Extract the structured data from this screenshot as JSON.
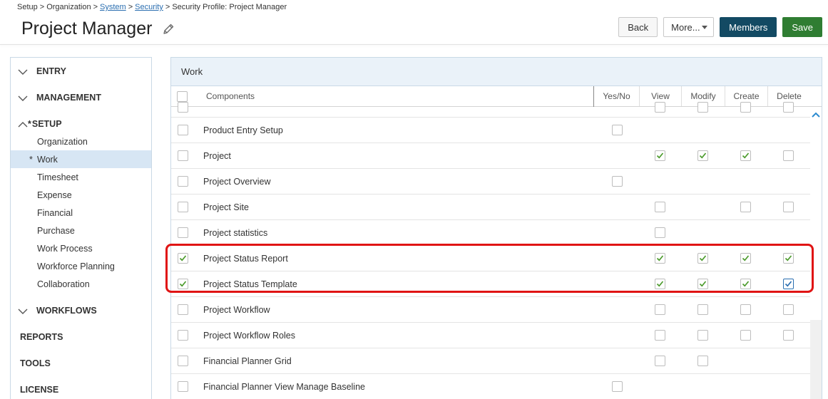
{
  "breadcrumb": {
    "items": [
      "Setup",
      "Organization",
      "System",
      "Security",
      "Security Profile: Project Manager"
    ],
    "separator": ">"
  },
  "page": {
    "title": "Project Manager"
  },
  "actions": {
    "back": "Back",
    "more": "More...",
    "members": "Members",
    "save": "Save"
  },
  "sidebar": {
    "sections": [
      {
        "label": "ENTRY",
        "state": "collapsed"
      },
      {
        "label": "MANAGEMENT",
        "state": "collapsed"
      },
      {
        "label": "SETUP",
        "state": "expanded",
        "mark": "*"
      },
      {
        "label": "WORKFLOWS",
        "state": "collapsed"
      },
      {
        "label": "REPORTS"
      },
      {
        "label": "TOOLS"
      },
      {
        "label": "LICENSE"
      }
    ],
    "setup_items": [
      {
        "label": "Organization"
      },
      {
        "label": "Work",
        "mark": "*",
        "active": true
      },
      {
        "label": "Timesheet"
      },
      {
        "label": "Expense"
      },
      {
        "label": "Financial"
      },
      {
        "label": "Purchase"
      },
      {
        "label": "Work Process"
      },
      {
        "label": "Workforce Planning"
      },
      {
        "label": "Collaboration"
      }
    ]
  },
  "panel": {
    "title": "Work",
    "columns": {
      "components": "Components",
      "yesno": "Yes/No",
      "view": "View",
      "modify": "Modify",
      "create": "Create",
      "delete": "Delete"
    },
    "rows": [
      {
        "name": "Product Entry Setup",
        "selected": false,
        "yesno": false,
        "view": null,
        "modify": null,
        "create": null,
        "delete": null
      },
      {
        "name": "Project",
        "selected": false,
        "yesno": null,
        "view": true,
        "modify": true,
        "create": true,
        "delete": false
      },
      {
        "name": "Project Overview",
        "selected": false,
        "yesno": false,
        "view": null,
        "modify": null,
        "create": null,
        "delete": null
      },
      {
        "name": "Project Site",
        "selected": false,
        "yesno": null,
        "view": false,
        "modify": null,
        "create": false,
        "delete": false
      },
      {
        "name": "Project statistics",
        "selected": false,
        "yesno": null,
        "view": false,
        "modify": null,
        "create": null,
        "delete": null
      },
      {
        "name": "Project Status Report",
        "selected": true,
        "yesno": null,
        "view": true,
        "modify": true,
        "create": true,
        "delete": true
      },
      {
        "name": "Project Status Template",
        "selected": true,
        "yesno": null,
        "view": true,
        "modify": true,
        "create": true,
        "delete": true
      },
      {
        "name": "Project Workflow",
        "selected": false,
        "yesno": null,
        "view": false,
        "modify": false,
        "create": false,
        "delete": false
      },
      {
        "name": "Project Workflow Roles",
        "selected": false,
        "yesno": null,
        "view": false,
        "modify": false,
        "create": false,
        "delete": false
      },
      {
        "name": "Financial Planner Grid",
        "selected": false,
        "yesno": null,
        "view": false,
        "modify": false,
        "create": null,
        "delete": null
      },
      {
        "name": "Financial Planner View Manage Baseline",
        "selected": false,
        "yesno": false,
        "view": null,
        "modify": null,
        "create": null,
        "delete": null
      }
    ]
  },
  "colors": {
    "check": "#4a9a2a",
    "highlight": "#e01414",
    "members_button": "#134a63",
    "save_button": "#2f7d32",
    "active_nav": "#d7e6f4",
    "link": "#2a6eb0"
  },
  "icons": {
    "edit": "pencil-icon",
    "collapsed": "chevron-down-icon",
    "expanded": "chevron-up-icon",
    "check": "check-icon",
    "scroll_up": "chevron-up-icon"
  }
}
